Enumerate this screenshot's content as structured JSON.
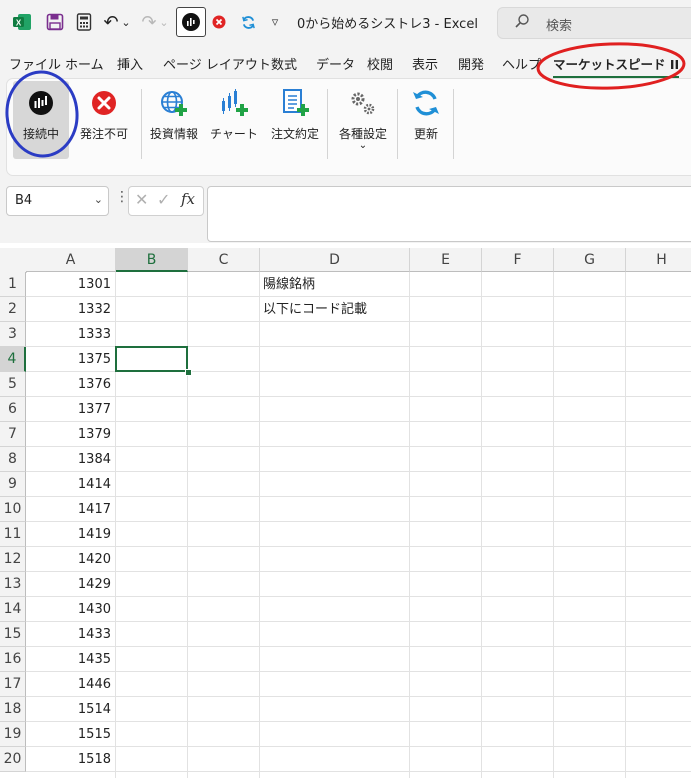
{
  "titlebar": {
    "undo_icon": "↶",
    "redo_icon": "↷",
    "dropdown": "⌄",
    "customize": "▿",
    "title": "0から始めるシストレ3  -  Excel",
    "search_placeholder": "検索"
  },
  "tabs": [
    "ファイル",
    "ホーム",
    "挿入",
    "ページ レイアウト",
    "数式",
    "データ",
    "校閲",
    "表示",
    "開発",
    "ヘルプ",
    "マーケットスピード II"
  ],
  "ribbon": {
    "connect": "接続中",
    "stop": "発注不可",
    "invest": "投資情報",
    "chart": "チャート",
    "orders": "注文約定",
    "settings": "各種設定",
    "settings_arrow": "⌄",
    "refresh": "更新"
  },
  "formula_bar": {
    "name_box": "B4",
    "name_box_arrow": "⌄",
    "dots": "⋮",
    "cancel": "✕",
    "enter": "✓",
    "fx": "fx",
    "value": ""
  },
  "columns": [
    "A",
    "B",
    "C",
    "D",
    "E",
    "F",
    "G",
    "H"
  ],
  "selected_cell": "B4",
  "rows": [
    {
      "num": "1",
      "a": "1301",
      "d": "陽線銘柄"
    },
    {
      "num": "2",
      "a": "1332",
      "d": "以下にコード記載"
    },
    {
      "num": "3",
      "a": "1333",
      "d": ""
    },
    {
      "num": "4",
      "a": "1375",
      "d": ""
    },
    {
      "num": "5",
      "a": "1376",
      "d": ""
    },
    {
      "num": "6",
      "a": "1377",
      "d": ""
    },
    {
      "num": "7",
      "a": "1379",
      "d": ""
    },
    {
      "num": "8",
      "a": "1384",
      "d": ""
    },
    {
      "num": "9",
      "a": "1414",
      "d": ""
    },
    {
      "num": "10",
      "a": "1417",
      "d": ""
    },
    {
      "num": "11",
      "a": "1419",
      "d": ""
    },
    {
      "num": "12",
      "a": "1420",
      "d": ""
    },
    {
      "num": "13",
      "a": "1429",
      "d": ""
    },
    {
      "num": "14",
      "a": "1430",
      "d": ""
    },
    {
      "num": "15",
      "a": "1433",
      "d": ""
    },
    {
      "num": "16",
      "a": "1435",
      "d": ""
    },
    {
      "num": "17",
      "a": "1446",
      "d": ""
    },
    {
      "num": "18",
      "a": "1514",
      "d": ""
    },
    {
      "num": "19",
      "a": "1515",
      "d": ""
    },
    {
      "num": "20",
      "a": "1518",
      "d": ""
    }
  ],
  "colors": {
    "excel_green": "#1e6f3d",
    "annotation_blue": "#2b3cc4",
    "annotation_red": "#e02020",
    "ribbon_active": "#d7d7d7"
  }
}
